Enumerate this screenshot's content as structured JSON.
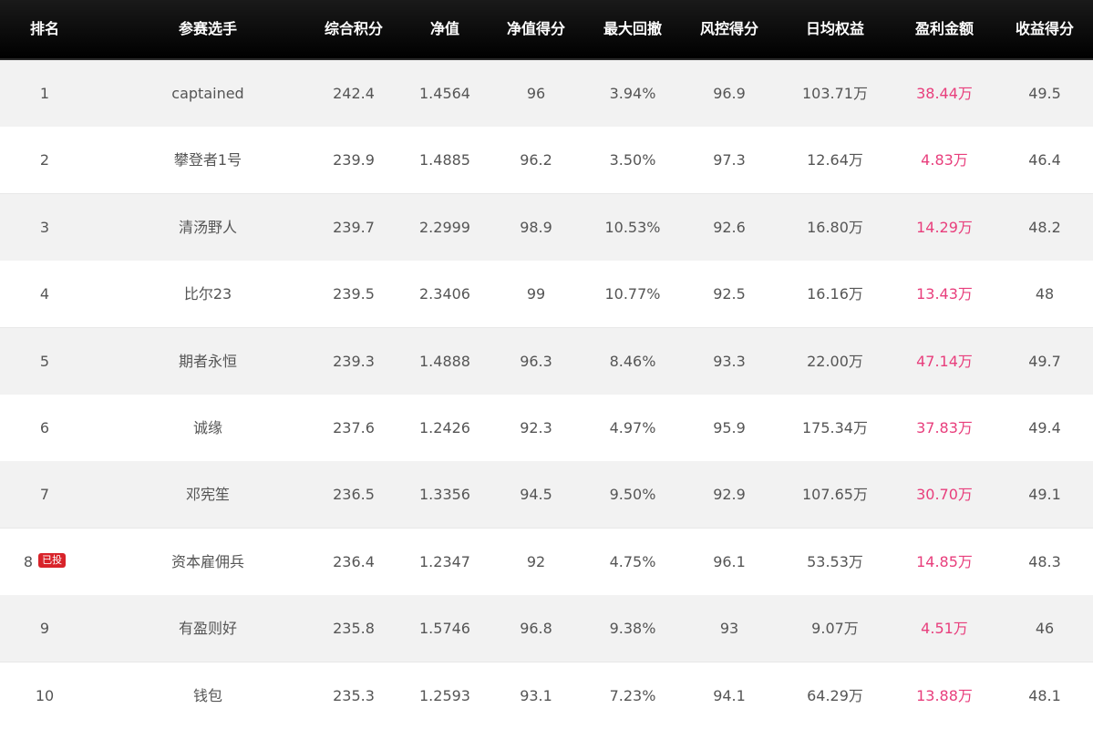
{
  "columns": [
    "排名",
    "参赛选手",
    "综合积分",
    "净值",
    "净值得分",
    "最大回撤",
    "风控得分",
    "日均权益",
    "盈利金额",
    "收益得分"
  ],
  "rows": [
    {
      "rank": "1",
      "badge": "",
      "player": "captained",
      "score": "242.4",
      "nav": "1.4564",
      "nav_score": "96",
      "drawdown": "3.94%",
      "risk_score": "96.9",
      "equity": "103.71万",
      "profit": "38.44万",
      "return_score": "49.5"
    },
    {
      "rank": "2",
      "badge": "",
      "player": "攀登者1号",
      "score": "239.9",
      "nav": "1.4885",
      "nav_score": "96.2",
      "drawdown": "3.50%",
      "risk_score": "97.3",
      "equity": "12.64万",
      "profit": "4.83万",
      "return_score": "46.4"
    },
    {
      "rank": "3",
      "badge": "",
      "player": "清汤野人",
      "score": "239.7",
      "nav": "2.2999",
      "nav_score": "98.9",
      "drawdown": "10.53%",
      "risk_score": "92.6",
      "equity": "16.80万",
      "profit": "14.29万",
      "return_score": "48.2"
    },
    {
      "rank": "4",
      "badge": "",
      "player": "比尔23",
      "score": "239.5",
      "nav": "2.3406",
      "nav_score": "99",
      "drawdown": "10.77%",
      "risk_score": "92.5",
      "equity": "16.16万",
      "profit": "13.43万",
      "return_score": "48"
    },
    {
      "rank": "5",
      "badge": "",
      "player": "期者永恒",
      "score": "239.3",
      "nav": "1.4888",
      "nav_score": "96.3",
      "drawdown": "8.46%",
      "risk_score": "93.3",
      "equity": "22.00万",
      "profit": "47.14万",
      "return_score": "49.7"
    },
    {
      "rank": "6",
      "badge": "",
      "player": "诚缘",
      "score": "237.6",
      "nav": "1.2426",
      "nav_score": "92.3",
      "drawdown": "4.97%",
      "risk_score": "95.9",
      "equity": "175.34万",
      "profit": "37.83万",
      "return_score": "49.4"
    },
    {
      "rank": "7",
      "badge": "",
      "player": "邓宪笙",
      "score": "236.5",
      "nav": "1.3356",
      "nav_score": "94.5",
      "drawdown": "9.50%",
      "risk_score": "92.9",
      "equity": "107.65万",
      "profit": "30.70万",
      "return_score": "49.1"
    },
    {
      "rank": "8",
      "badge": "已投",
      "player": "资本雇佣兵",
      "score": "236.4",
      "nav": "1.2347",
      "nav_score": "92",
      "drawdown": "4.75%",
      "risk_score": "96.1",
      "equity": "53.53万",
      "profit": "14.85万",
      "return_score": "48.3"
    },
    {
      "rank": "9",
      "badge": "",
      "player": "有盈则好",
      "score": "235.8",
      "nav": "1.5746",
      "nav_score": "96.8",
      "drawdown": "9.38%",
      "risk_score": "93",
      "equity": "9.07万",
      "profit": "4.51万",
      "return_score": "46"
    },
    {
      "rank": "10",
      "badge": "",
      "player": "钱包",
      "score": "235.3",
      "nav": "1.2593",
      "nav_score": "93.1",
      "drawdown": "7.23%",
      "risk_score": "94.1",
      "equity": "64.29万",
      "profit": "13.88万",
      "return_score": "48.1"
    }
  ],
  "colors": {
    "header_bg": "#000000",
    "header_text": "#ffffff",
    "row_alt_bg": "#f2f2f2",
    "text": "#555555",
    "profit": "#e83e7c",
    "badge": "#d8232a"
  }
}
